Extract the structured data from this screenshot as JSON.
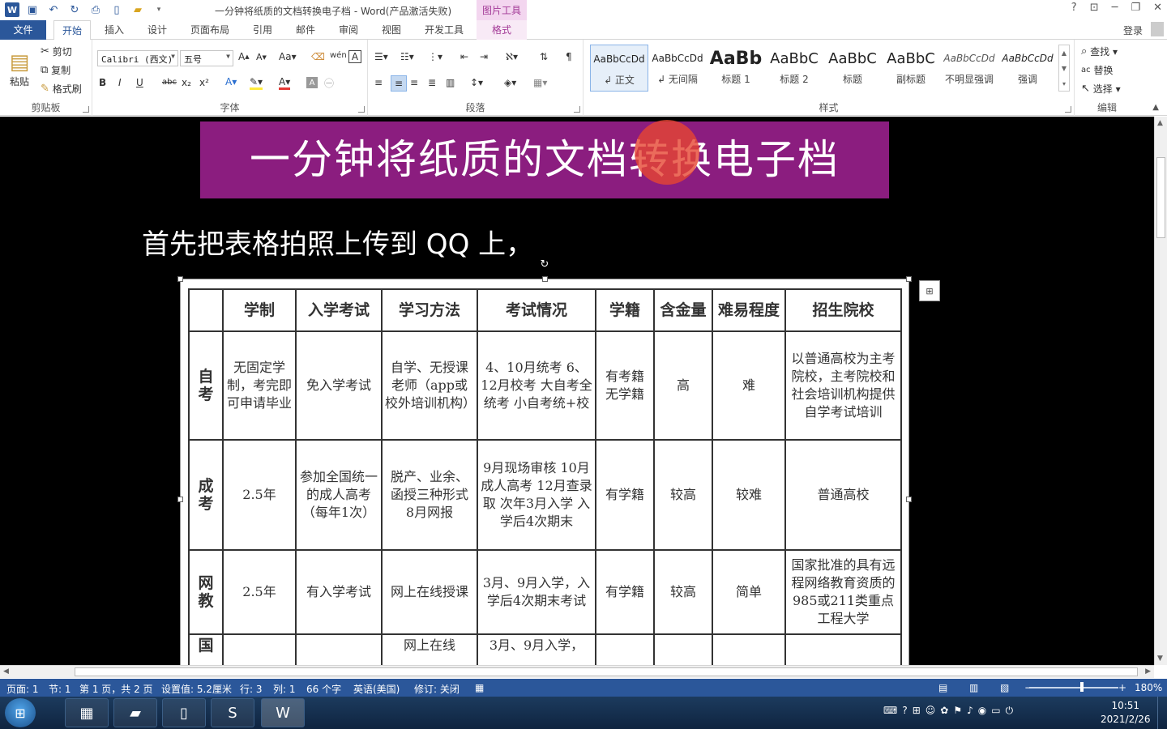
{
  "titlebar": {
    "title": "一分钟将纸质的文档转换电子档 - Word(产品激活失败)",
    "context_tool": "图片工具",
    "help": "?",
    "minimize": "─",
    "restore": "❐",
    "close": "✕"
  },
  "tabs": [
    "文件",
    "开始",
    "插入",
    "设计",
    "页面布局",
    "引用",
    "邮件",
    "审阅",
    "视图",
    "开发工具",
    "格式"
  ],
  "login": "登录",
  "ribbon": {
    "clipboard": {
      "paste": "粘贴",
      "cut": "剪切",
      "copy": "复制",
      "format_painter": "格式刷",
      "label": "剪贴板"
    },
    "font": {
      "font_name": "Calibri (西文)",
      "font_size": "五号",
      "label": "字体",
      "bold": "B",
      "italic": "I",
      "underline": "U",
      "strike": "abc",
      "sub": "x₂",
      "sup": "x²"
    },
    "paragraph": {
      "label": "段落"
    },
    "styles": {
      "label": "样式",
      "items": [
        {
          "preview": "AaBbCcDd",
          "label": "↲ 正文"
        },
        {
          "preview": "AaBbCcDd",
          "label": "↲ 无间隔"
        },
        {
          "preview": "AaBb",
          "label": "标题 1"
        },
        {
          "preview": "AaBbC",
          "label": "标题 2"
        },
        {
          "preview": "AaBbC",
          "label": "标题"
        },
        {
          "preview": "AaBbC",
          "label": "副标题"
        },
        {
          "preview": "AaBbCcDd",
          "label": "不明显强调"
        },
        {
          "preview": "AaBbCcDd",
          "label": "强调"
        }
      ]
    },
    "editing": {
      "find": "查找",
      "replace": "替换",
      "select": "选择",
      "label": "编辑"
    }
  },
  "document": {
    "heading": "一分钟将纸质的文档转换电子档",
    "paragraph": "首先把表格拍照上传到 QQ 上，",
    "table": {
      "headers": [
        "",
        "学制",
        "入学考试",
        "学习方法",
        "考试情况",
        "学籍",
        "含金量",
        "难易程度",
        "招生院校"
      ],
      "rows": [
        [
          "自考",
          "无固定学制，考完即可申请毕业",
          "免入学考试",
          "自学、无授课老师（app或校外培训机构）",
          "4、10月统考 6、12月校考 大自考全统考 小自考统+校",
          "有考籍 无学籍",
          "高",
          "难",
          "以普通高校为主考院校，主考院校和社会培训机构提供自学考试培训"
        ],
        [
          "成考",
          "2.5年",
          "参加全国统一的成人高考（每年1次）",
          "脱产、业余、函授三种形式 8月网报",
          "9月现场审核 10月成人高考 12月查录取 次年3月入学 入学后4次期末",
          "有学籍",
          "较高",
          "较难",
          "普通高校"
        ],
        [
          "网教",
          "2.5年",
          "有入学考试",
          "网上在线授课",
          "3月、9月入学，入学后4次期末考试",
          "有学籍",
          "较高",
          "简单",
          "国家批准的具有远程网络教育资质的985或211类重点工程大学"
        ],
        [
          "国",
          "",
          "",
          "网上在线",
          "3月、9月入学，",
          "",
          "",
          "",
          ""
        ]
      ]
    }
  },
  "statusbar": {
    "page": "页面: 1",
    "section": "节: 1",
    "page_of": "第 1 页，共 2 页",
    "setting": "设置值: 5.2厘米",
    "line": "行: 3",
    "column": "列: 1",
    "words": "66 个字",
    "language": "英语(美国)",
    "track": "修订: 关闭",
    "zoom": "180%"
  },
  "taskbar": {
    "time": "10:51",
    "date": "2021/2/26"
  },
  "colors": {
    "word_blue": "#2b579a",
    "heading_bg": "#8b1d7f",
    "context_tab": "#a33a97"
  }
}
